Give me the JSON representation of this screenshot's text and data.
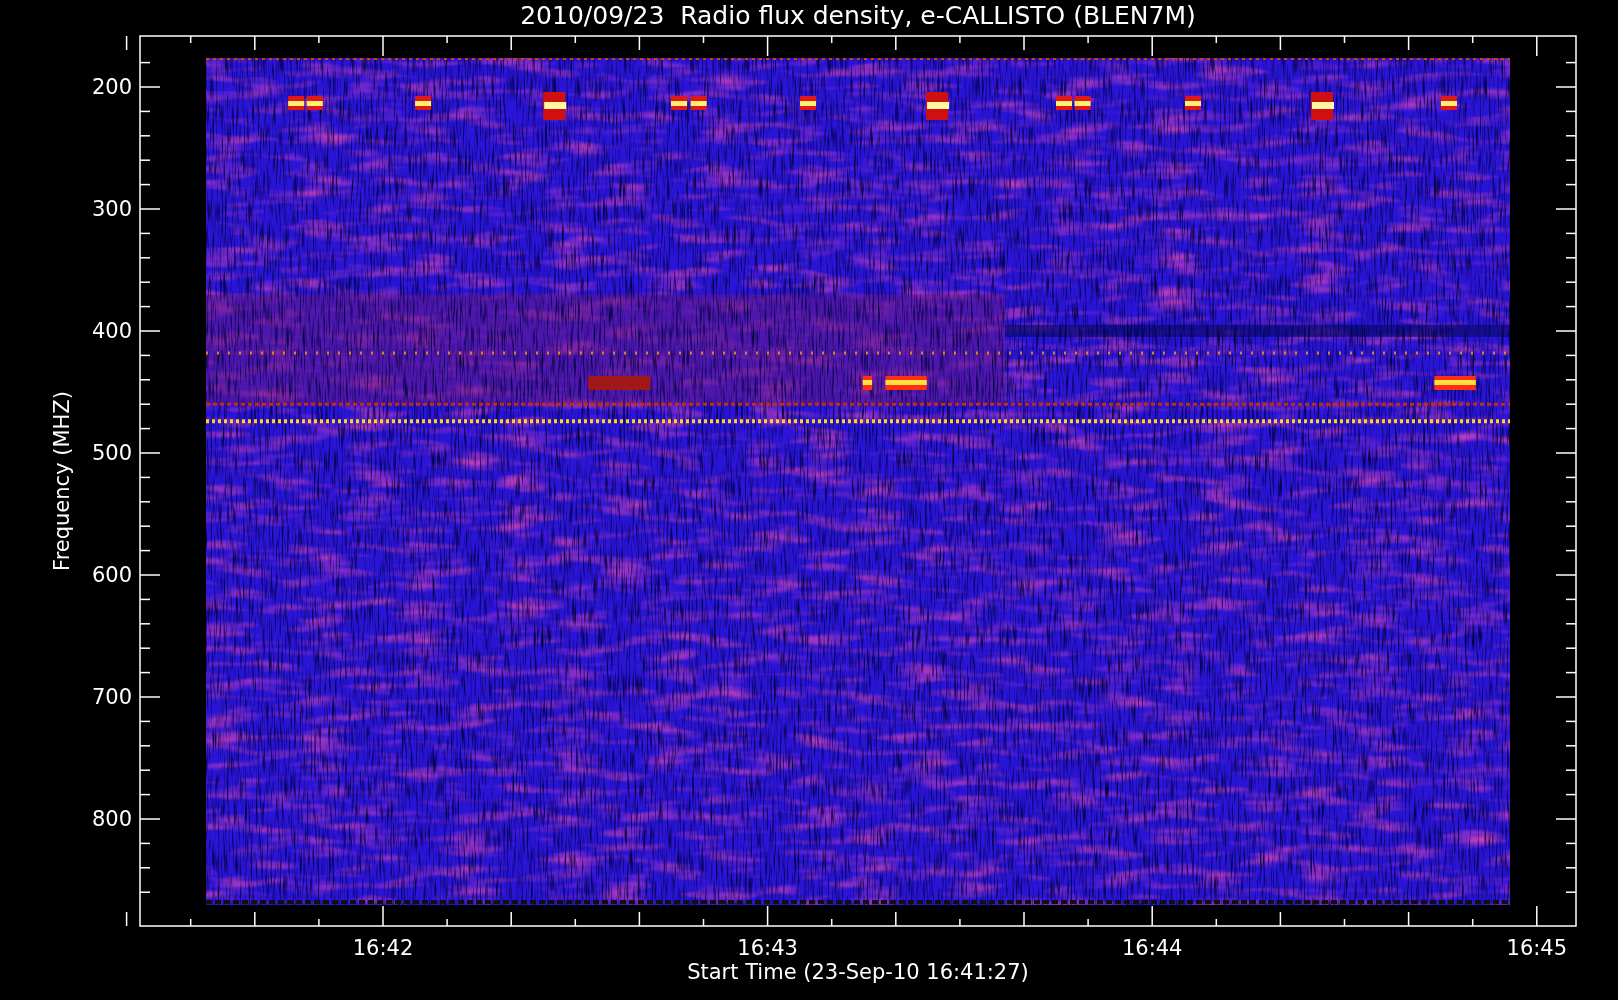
{
  "title": "2010/09/23  Radio flux density, e-CALLISTO (BLEN7M)",
  "y_axis": {
    "label": "Frequency (MHZ)",
    "ticks": [
      "200",
      "300",
      "400",
      "500",
      "600",
      "700",
      "800"
    ]
  },
  "x_axis": {
    "label": "Start Time (23-Sep-10 16:41:27)",
    "ticks": [
      "16:42",
      "16:43",
      "16:44",
      "16:45"
    ]
  }
}
